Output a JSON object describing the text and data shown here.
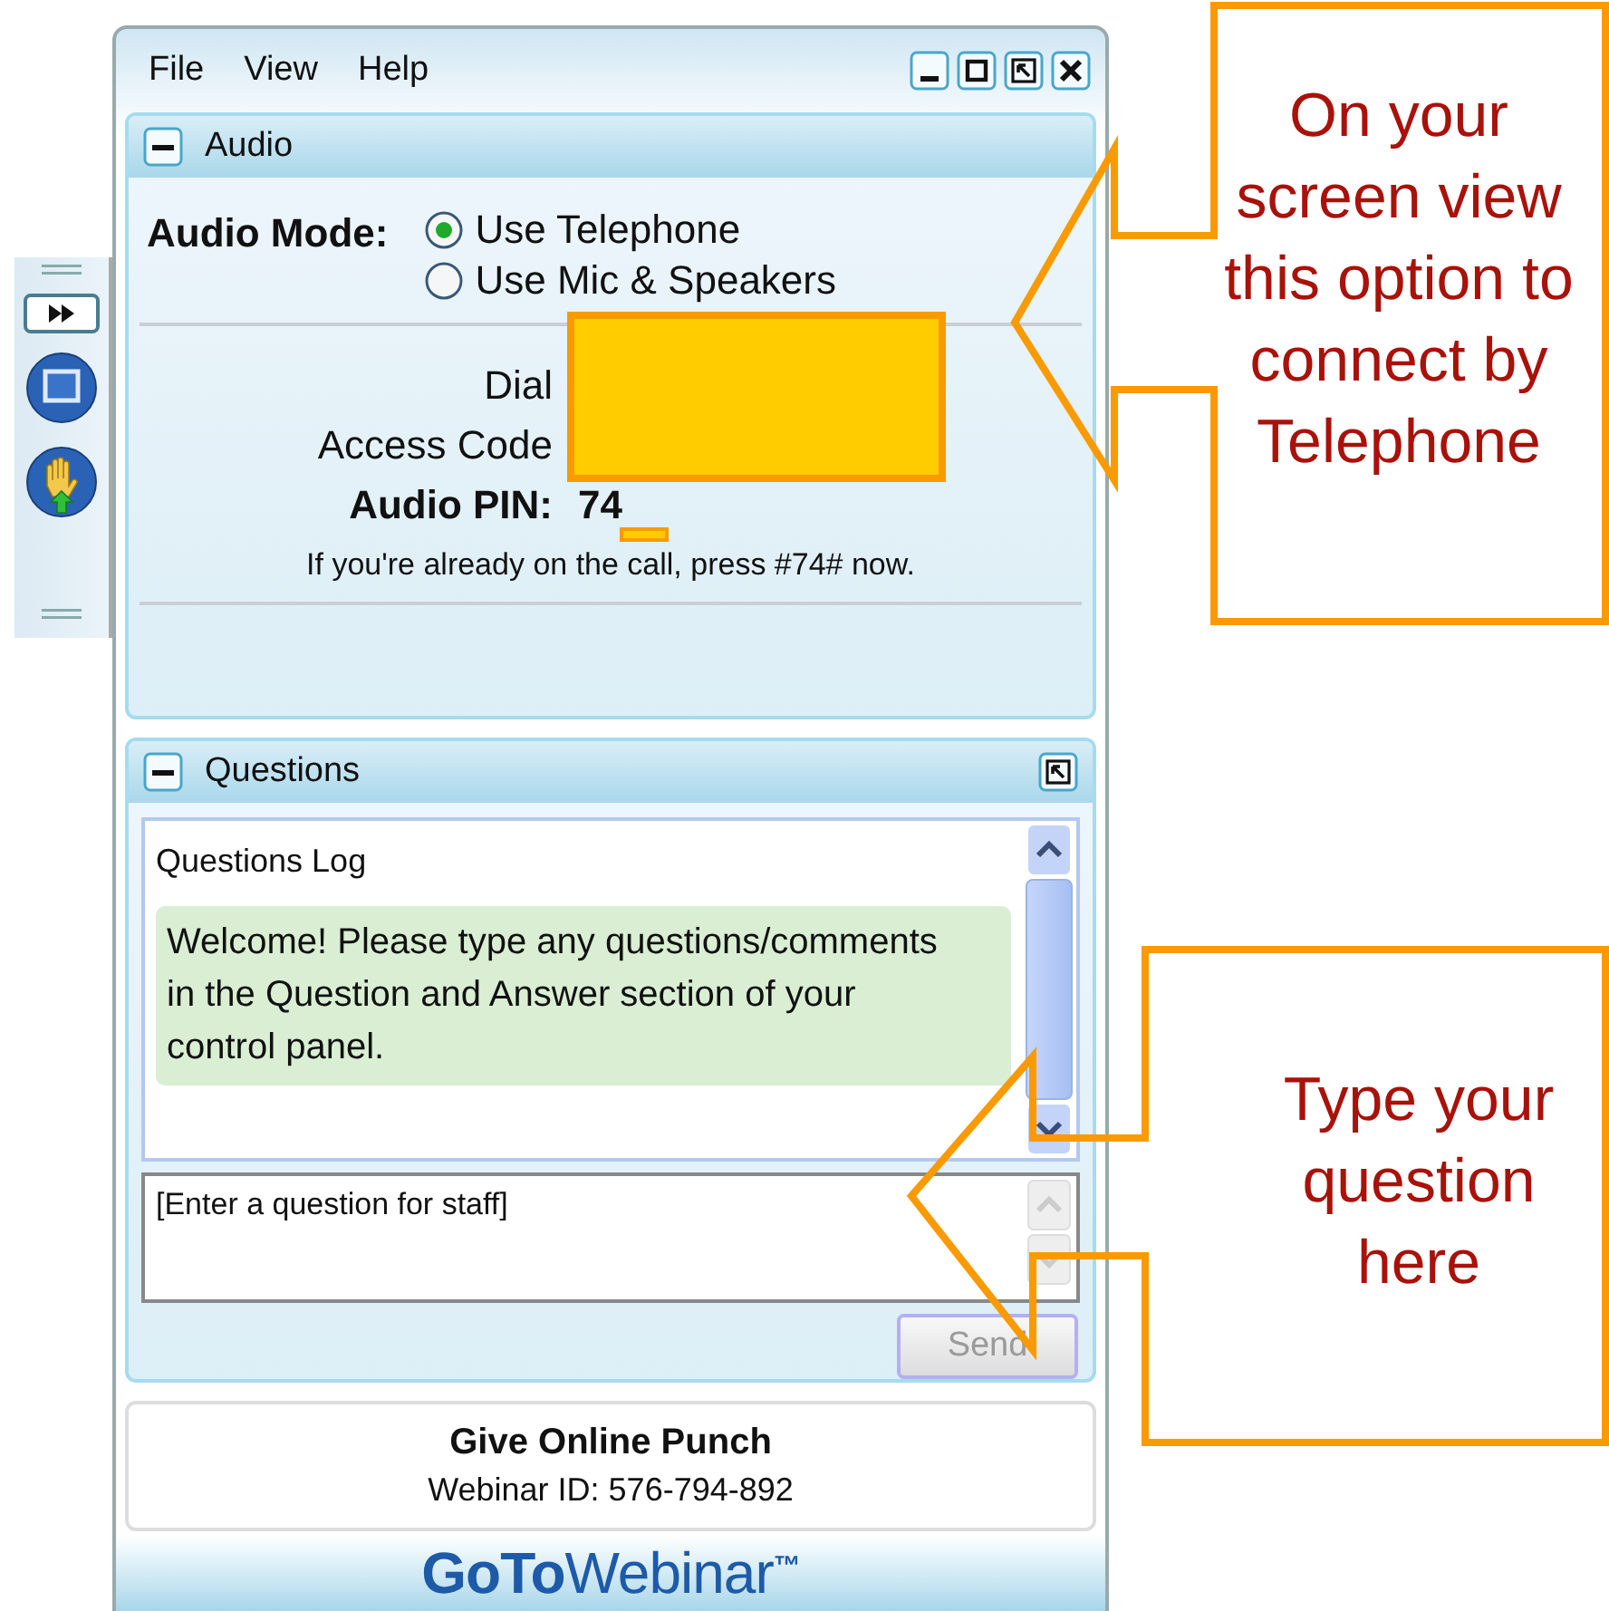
{
  "menu": [
    {
      "label": "File"
    },
    {
      "label": "View"
    },
    {
      "label": "Help"
    }
  ],
  "audio": {
    "title": "Audio",
    "mode_label": "Audio Mode:",
    "options": [
      {
        "label": "Use Telephone",
        "selected": true
      },
      {
        "label": "Use Mic & Speakers",
        "selected": false
      }
    ],
    "dial_label": "Dial",
    "access_code_label": "Access Code",
    "pin_label": "Audio PIN:",
    "pin_value": "74",
    "note": "If you're already on the call, press #74# now."
  },
  "questions": {
    "title": "Questions",
    "log_title": "Questions Log",
    "messages": [
      {
        "text": "Welcome! Please type any questions/comments in the Question and Answer section of your control panel."
      }
    ],
    "input": {
      "placeholder": "[Enter a question for staff]"
    },
    "send": {
      "label": "Send",
      "disabled": true
    }
  },
  "webinar": {
    "title": "Give Online Punch",
    "id": "Webinar ID: 576-794-892"
  },
  "brand": {
    "bold": "GoTo",
    "light": "Webinar",
    "mark": "™"
  },
  "callouts": [
    {
      "text": "On your screen view this option to connect by Telephone"
    },
    {
      "text": "Type your question here"
    }
  ]
}
